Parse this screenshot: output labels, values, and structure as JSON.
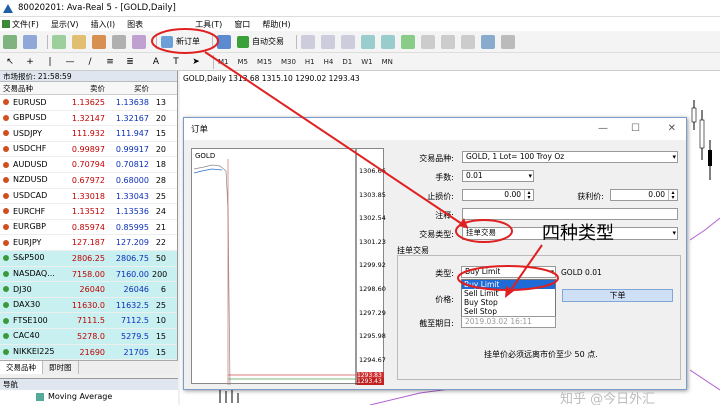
{
  "window": {
    "title": "80020201: Ava-Real 5 - [GOLD,Daily]"
  },
  "menu": [
    "文件(F)",
    "显示(V)",
    "插入(I)",
    "图表",
    "工具(T)",
    "窗口",
    "帮助(H)"
  ],
  "toolbar": {
    "new_order_label": "新订单",
    "auto_trade_label": "自动交易"
  },
  "timeframes": [
    "M1",
    "M5",
    "M15",
    "M30",
    "H1",
    "H4",
    "D1",
    "W1",
    "MN"
  ],
  "market_watch": {
    "header": "市场报价: 21:58:59",
    "columns": [
      "交易品种",
      "卖价",
      "买价",
      ""
    ],
    "rows": [
      {
        "symbol": "EURUSD",
        "bid": "1.13625",
        "ask": "1.13638",
        "spread": "13",
        "dot": "#d05020",
        "bg": "#ffffff"
      },
      {
        "symbol": "GBPUSD",
        "bid": "1.32147",
        "ask": "1.32167",
        "spread": "20",
        "dot": "#d05020",
        "bg": "#ffffff"
      },
      {
        "symbol": "USDJPY",
        "bid": "111.932",
        "ask": "111.947",
        "spread": "15",
        "dot": "#d05020",
        "bg": "#ffffff"
      },
      {
        "symbol": "USDCHF",
        "bid": "0.99897",
        "ask": "0.99917",
        "spread": "20",
        "dot": "#d05020",
        "bg": "#ffffff"
      },
      {
        "symbol": "AUDUSD",
        "bid": "0.70794",
        "ask": "0.70812",
        "spread": "18",
        "dot": "#d05020",
        "bg": "#ffffff"
      },
      {
        "symbol": "NZDUSD",
        "bid": "0.67972",
        "ask": "0.68000",
        "spread": "28",
        "dot": "#d05020",
        "bg": "#ffffff"
      },
      {
        "symbol": "USDCAD",
        "bid": "1.33018",
        "ask": "1.33043",
        "spread": "25",
        "dot": "#d05020",
        "bg": "#ffffff"
      },
      {
        "symbol": "EURCHF",
        "bid": "1.13512",
        "ask": "1.13536",
        "spread": "24",
        "dot": "#d05020",
        "bg": "#ffffff"
      },
      {
        "symbol": "EURGBP",
        "bid": "0.85974",
        "ask": "0.85995",
        "spread": "21",
        "dot": "#d05020",
        "bg": "#ffffff"
      },
      {
        "symbol": "EURJPY",
        "bid": "127.187",
        "ask": "127.209",
        "spread": "22",
        "dot": "#d05020",
        "bg": "#ffffff"
      },
      {
        "symbol": "S&P500",
        "bid": "2806.25",
        "ask": "2806.75",
        "spread": "50",
        "dot": "#3a9a3a",
        "bg": "#c8f0f0"
      },
      {
        "symbol": "NASDAQ...",
        "bid": "7158.00",
        "ask": "7160.00",
        "spread": "200",
        "dot": "#3a9a3a",
        "bg": "#c8f0f0"
      },
      {
        "symbol": "DJ30",
        "bid": "26040",
        "ask": "26046",
        "spread": "6",
        "dot": "#3a9a3a",
        "bg": "#c8f0f0"
      },
      {
        "symbol": "DAX30",
        "bid": "11630.0",
        "ask": "11632.5",
        "spread": "25",
        "dot": "#3a9a3a",
        "bg": "#c8f0f0"
      },
      {
        "symbol": "FTSE100",
        "bid": "7111.5",
        "ask": "7112.5",
        "spread": "10",
        "dot": "#3a9a3a",
        "bg": "#c8f0f0"
      },
      {
        "symbol": "CAC40",
        "bid": "5278.0",
        "ask": "5279.5",
        "spread": "15",
        "dot": "#3a9a3a",
        "bg": "#c8f0f0"
      },
      {
        "symbol": "NIKKEI225",
        "bid": "21690",
        "ask": "21705",
        "spread": "15",
        "dot": "#3a9a3a",
        "bg": "#c8f0f0"
      }
    ],
    "tabs": [
      "交易品种",
      "即时图"
    ]
  },
  "navigator": {
    "header": "导航",
    "item": "Moving Average"
  },
  "chart": {
    "title": "GOLD,Daily  1313.68 1315.10 1290.02 1293.43"
  },
  "order_dialog": {
    "title": "订单",
    "mini_chart_label": "GOLD",
    "price_ticks": [
      "1306.66",
      "1303.85",
      "1302.54",
      "1301.23",
      "1299.92",
      "1298.60",
      "1297.29",
      "1295.98",
      "1294.67"
    ],
    "price_tag_high": "1293.83",
    "price_tag_low": "1293.43",
    "symbol_label": "交易品种:",
    "symbol_value": "GOLD, 1 Lot= 100 Troy Oz",
    "volume_label": "手数:",
    "volume_value": "0.01",
    "sl_label": "止损价:",
    "sl_value": "0.00",
    "tp_label": "获利价:",
    "tp_value": "0.00",
    "comment_label": "注释:",
    "type_label": "交易类型:",
    "type_value": "挂单交易",
    "pending_group": "挂单交易",
    "kind_label": "类型:",
    "kind_value": "Buy Limit",
    "kind_symbol": "GOLD 0.01",
    "kind_options": [
      "Buy Limit",
      "Sell Limit",
      "Buy Stop",
      "Sell Stop"
    ],
    "price_label": "价格:",
    "expiry_label": "截至期日:",
    "expiry_value": "2019.03.02 16:11",
    "place_button": "下单",
    "note": "挂单价必须远离市价至少 50 点."
  },
  "annotation": {
    "text": "四种类型",
    "color": "#e02020"
  },
  "watermark": "知乎 @今日外汇"
}
